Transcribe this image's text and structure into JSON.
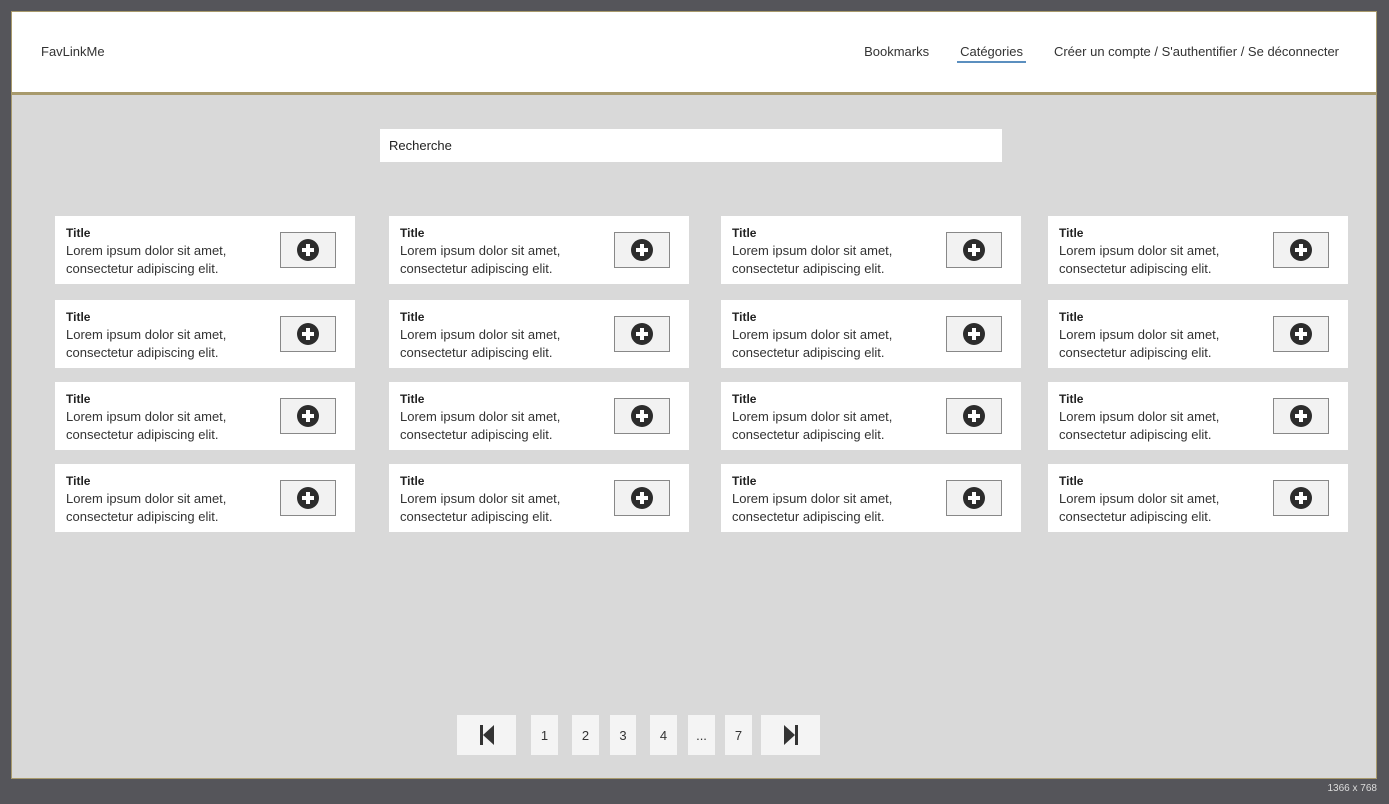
{
  "header": {
    "brand": "FavLinkMe",
    "nav": [
      "Bookmarks",
      "Catégories",
      "Créer un compte / S'authentifier / Se déconnecter"
    ]
  },
  "search": {
    "placeholder": "Recherche"
  },
  "cards": {
    "title": "Title",
    "desc_line1": "Lorem ipsum dolor sit amet,",
    "desc_line2": "consectetur adipiscing elit.",
    "count": 16,
    "add_icon": "plus-circle-icon"
  },
  "pagination": {
    "first_icon": "first-page-icon",
    "pages": [
      "1",
      "2",
      "3",
      "4",
      "...",
      "7"
    ],
    "last_icon": "last-page-icon"
  },
  "resolution_label": "1366 x 768",
  "colors": {
    "accent_underline": "#5b8fbf",
    "frame_border": "#a89a6c",
    "backdrop": "#55555a",
    "content_bg": "#d9d9d9"
  }
}
